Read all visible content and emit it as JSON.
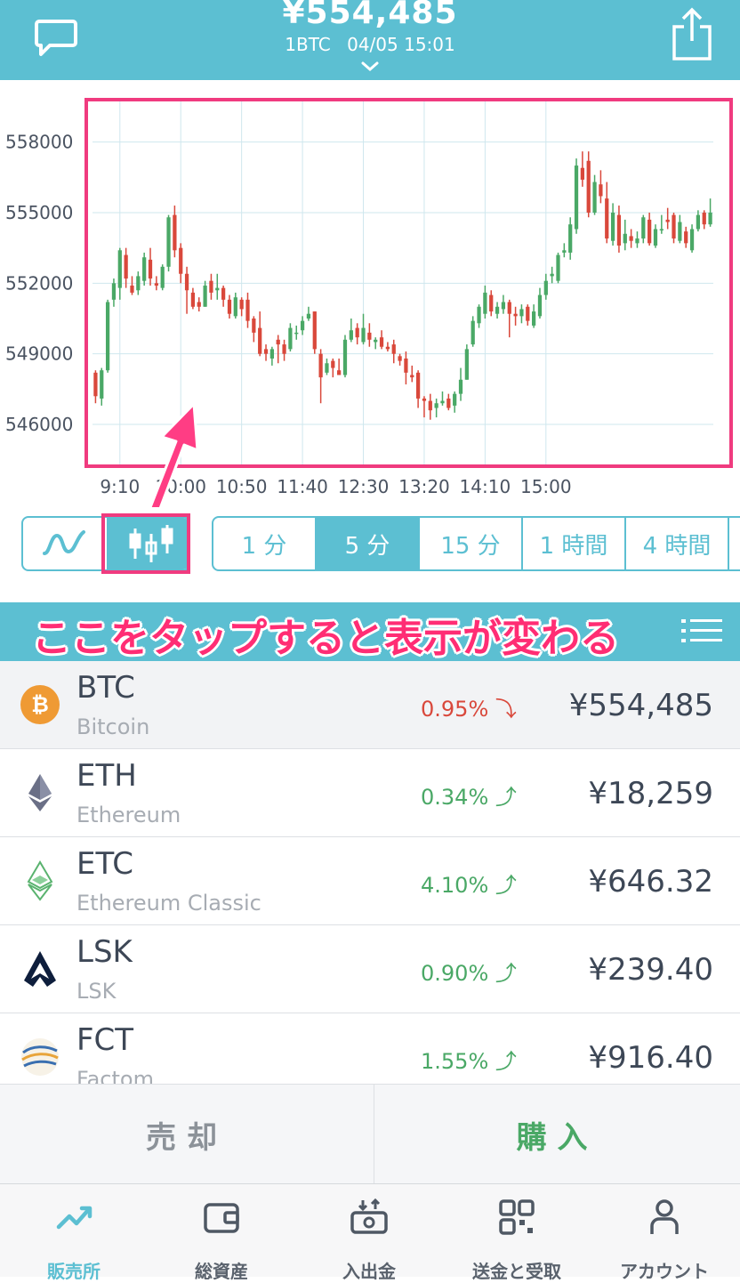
{
  "header": {
    "price": "¥554,485",
    "unit": "1BTC",
    "timestamp": "04/05 15:01",
    "icons": [
      "chat-icon",
      "share-icon",
      "chevron-down-icon"
    ]
  },
  "chart_data": {
    "type": "candlestick",
    "y_ticks": [
      558000,
      555000,
      552000,
      549000,
      546000
    ],
    "y_tick_labels": [
      "558000",
      "555000",
      "552000",
      "549000",
      "546000"
    ],
    "x_tick_labels": [
      "9:10",
      "10:00",
      "10:50",
      "11:40",
      "12:30",
      "13:20",
      "14:10",
      "15:00"
    ],
    "ylim": [
      544300,
      559800
    ],
    "interval": "5 分",
    "candles": [
      [
        548200,
        547200,
        548300,
        546900
      ],
      [
        547100,
        548300,
        548400,
        546800
      ],
      [
        548300,
        551200,
        551300,
        548200
      ],
      [
        551300,
        552000,
        552200,
        551000
      ],
      [
        551800,
        553400,
        553500,
        551300
      ],
      [
        553200,
        552200,
        553500,
        551800
      ],
      [
        551900,
        551600,
        552300,
        551500
      ],
      [
        551700,
        552300,
        552500,
        551500
      ],
      [
        552100,
        553100,
        553300,
        551900
      ],
      [
        553000,
        552200,
        553500,
        551900
      ],
      [
        552000,
        551900,
        552300,
        551700
      ],
      [
        551800,
        552700,
        552800,
        551700
      ],
      [
        552700,
        554800,
        554900,
        552500
      ],
      [
        554900,
        553400,
        555300,
        553100
      ],
      [
        553500,
        552400,
        553700,
        552000
      ],
      [
        552400,
        551700,
        552700,
        550700
      ],
      [
        551600,
        551000,
        551800,
        550900
      ],
      [
        551200,
        551000,
        551400,
        550800
      ],
      [
        551000,
        551900,
        552100,
        551000
      ],
      [
        552100,
        551600,
        552400,
        551300
      ],
      [
        551700,
        551800,
        552400,
        551300
      ],
      [
        551800,
        551300,
        551900,
        551000
      ],
      [
        551300,
        550700,
        551500,
        550500
      ],
      [
        550600,
        551400,
        551600,
        550500
      ],
      [
        551300,
        550900,
        551400,
        550600
      ],
      [
        551300,
        550400,
        551600,
        550100
      ],
      [
        550500,
        549900,
        550600,
        549500
      ],
      [
        550100,
        549000,
        550800,
        548900
      ],
      [
        549200,
        549000,
        549400,
        548700
      ],
      [
        548800,
        549200,
        549300,
        548500
      ],
      [
        549600,
        549400,
        549800,
        548600
      ],
      [
        549400,
        549000,
        549600,
        548700
      ],
      [
        549200,
        550100,
        550300,
        549100
      ],
      [
        549900,
        549900,
        550200,
        549600
      ],
      [
        550000,
        550400,
        550600,
        549800
      ],
      [
        550500,
        550700,
        551000,
        550400
      ],
      [
        550800,
        549200,
        550800,
        549000
      ],
      [
        549000,
        548000,
        549200,
        546900
      ],
      [
        548200,
        548600,
        548800,
        548100
      ],
      [
        548700,
        548400,
        548800,
        548000
      ],
      [
        548300,
        548100,
        548800,
        548100
      ],
      [
        548100,
        549600,
        549800,
        548000
      ],
      [
        549600,
        550000,
        550500,
        549500
      ],
      [
        550100,
        549700,
        550300,
        549400
      ],
      [
        549500,
        550100,
        550700,
        549400
      ],
      [
        549900,
        549600,
        550300,
        549300
      ],
      [
        549500,
        549600,
        549700,
        549200
      ],
      [
        549700,
        549300,
        550000,
        549200
      ],
      [
        549300,
        549200,
        549500,
        549100
      ],
      [
        549400,
        549000,
        549600,
        548600
      ],
      [
        548900,
        548700,
        549000,
        548500
      ],
      [
        548800,
        548200,
        549100,
        547700
      ],
      [
        548100,
        548000,
        548500,
        547800
      ],
      [
        548200,
        547100,
        548300,
        546700
      ],
      [
        547100,
        547000,
        547200,
        546300
      ],
      [
        547000,
        546600,
        547300,
        546200
      ],
      [
        546700,
        546900,
        547100,
        546300
      ],
      [
        546900,
        547000,
        547400,
        546800
      ],
      [
        547100,
        546700,
        547300,
        546600
      ],
      [
        546800,
        547300,
        547400,
        546500
      ],
      [
        547300,
        547900,
        548400,
        547000
      ],
      [
        547900,
        549200,
        549400,
        547900
      ],
      [
        549400,
        550400,
        550600,
        549300
      ],
      [
        550300,
        551000,
        551100,
        550100
      ],
      [
        550700,
        551600,
        551900,
        550500
      ],
      [
        551500,
        550800,
        551700,
        550600
      ],
      [
        550700,
        551000,
        551200,
        550500
      ],
      [
        550900,
        551200,
        551500,
        550700
      ],
      [
        551200,
        550700,
        551300,
        549700
      ],
      [
        550700,
        550600,
        551000,
        550200
      ],
      [
        550600,
        550900,
        551100,
        550300
      ],
      [
        551000,
        550400,
        551100,
        550200
      ],
      [
        550200,
        550800,
        551100,
        550100
      ],
      [
        550600,
        551500,
        551800,
        550500
      ],
      [
        551500,
        552100,
        552400,
        551300
      ],
      [
        552300,
        552400,
        552700,
        552000
      ],
      [
        552100,
        553200,
        553300,
        552000
      ],
      [
        553300,
        553400,
        553700,
        553100
      ],
      [
        553300,
        554500,
        554800,
        553000
      ],
      [
        554300,
        557000,
        557300,
        554100
      ],
      [
        556900,
        556400,
        557600,
        556100
      ],
      [
        557200,
        555000,
        557600,
        554800
      ],
      [
        555000,
        556300,
        556600,
        554900
      ],
      [
        556200,
        555700,
        556800,
        555400
      ],
      [
        555600,
        553900,
        556300,
        553700
      ],
      [
        553800,
        555000,
        555400,
        553600
      ],
      [
        554900,
        553600,
        555300,
        553300
      ],
      [
        553700,
        554100,
        554700,
        553400
      ],
      [
        554000,
        553800,
        554300,
        553500
      ],
      [
        553700,
        553900,
        554200,
        553500
      ],
      [
        553900,
        554800,
        554900,
        553700
      ],
      [
        554700,
        553700,
        555000,
        553600
      ],
      [
        553600,
        554300,
        554500,
        553500
      ],
      [
        554300,
        554300,
        554900,
        554100
      ],
      [
        554700,
        554600,
        555200,
        554300
      ],
      [
        554900,
        553900,
        555000,
        553700
      ],
      [
        553800,
        554600,
        554900,
        553700
      ],
      [
        554200,
        553700,
        554400,
        553500
      ],
      [
        553400,
        554300,
        554500,
        553300
      ],
      [
        554300,
        554900,
        555100,
        554200
      ],
      [
        555000,
        554500,
        555100,
        554300
      ],
      [
        554500,
        555000,
        555600,
        554400
      ]
    ]
  },
  "controls": {
    "chart_types": [
      "line-chart-icon",
      "candlestick-chart-icon"
    ],
    "selected_type": "candlestick-chart-icon",
    "periods": [
      "1 分",
      "5 分",
      "15 分",
      "1 時間",
      "4 時間",
      ""
    ],
    "selected_period": "5 分"
  },
  "annotation": {
    "text": "ここをタップすると表示が変わる",
    "highlight_color": "#f03b7f"
  },
  "menu": {
    "icon": "list-menu-icon"
  },
  "coins": [
    {
      "symbol": "BTC",
      "name": "Bitcoin",
      "change": "0.95%",
      "direction": "down",
      "price": "¥554,485",
      "icon": "bitcoin-icon",
      "selected": true
    },
    {
      "symbol": "ETH",
      "name": "Ethereum",
      "change": "0.34%",
      "direction": "up",
      "price": "¥18,259",
      "icon": "ethereum-icon",
      "selected": false
    },
    {
      "symbol": "ETC",
      "name": "Ethereum Classic",
      "change": "4.10%",
      "direction": "up",
      "price": "¥646.32",
      "icon": "ethereum-classic-icon",
      "selected": false
    },
    {
      "symbol": "LSK",
      "name": "LSK",
      "change": "0.90%",
      "direction": "up",
      "price": "¥239.40",
      "icon": "lisk-icon",
      "selected": false
    },
    {
      "symbol": "FCT",
      "name": "Factom",
      "change": "1.55%",
      "direction": "up",
      "price": "¥916.40",
      "icon": "factom-icon",
      "selected": false
    }
  ],
  "trade": {
    "sell": "売却",
    "buy": "購入"
  },
  "tabs": [
    {
      "label": "販売所",
      "icon": "trend-chart-icon",
      "active": true
    },
    {
      "label": "総資産",
      "icon": "wallet-icon",
      "active": false
    },
    {
      "label": "入出金",
      "icon": "deposit-withdraw-icon",
      "active": false
    },
    {
      "label": "送金と受取",
      "icon": "qr-code-icon",
      "active": false
    },
    {
      "label": "アカウント",
      "icon": "account-icon",
      "active": false
    }
  ],
  "colors": {
    "brand": "#5cbfd2",
    "up": "#4aa866",
    "down": "#d9483b",
    "highlight": "#f03b7f"
  }
}
